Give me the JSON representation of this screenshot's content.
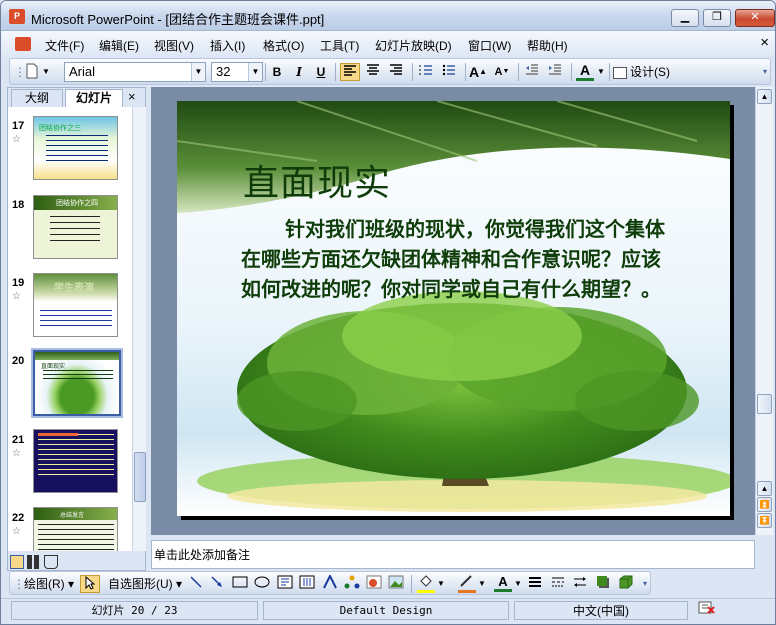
{
  "window": {
    "app_icon_text": "P",
    "title": "Microsoft PowerPoint - [团结合作主题班会课件.ppt]"
  },
  "caption_buttons": {
    "minimize": "▁",
    "restore": "❐",
    "close": "✕"
  },
  "menu": [
    "文件(F)",
    "编辑(E)",
    "视图(V)",
    "插入(I)",
    "格式(O)",
    "工具(T)",
    "幻灯片放映(D)",
    "窗口(W)",
    "帮助(H)"
  ],
  "menu_close": "×",
  "toolbar": {
    "font_name": "Arial",
    "font_size": "32",
    "bold": "B",
    "italic": "I",
    "underline": "U",
    "increase_font": "A",
    "decrease_font": "A",
    "font_color": "A",
    "design_label": "设计(S)"
  },
  "panel": {
    "tab_outline": "大纲",
    "tab_slides": "幻灯片",
    "close": "×"
  },
  "slides": [
    {
      "num": "17",
      "star": "☆",
      "title": "团结协作之三"
    },
    {
      "num": "18",
      "star": "",
      "title": "团结协作之四"
    },
    {
      "num": "19",
      "star": "☆",
      "title": "学生表演"
    },
    {
      "num": "20",
      "star": "",
      "title": "直面现实"
    },
    {
      "num": "21",
      "star": "☆",
      "title": ""
    },
    {
      "num": "22",
      "star": "☆",
      "title": "总结发言"
    }
  ],
  "selected_slide": "20",
  "slide": {
    "title": "直面现实",
    "body": "针对我们班级的现状，你觉得我们这个集体在哪些方面还欠缺团体精神和合作意识呢？应该如何改进的呢？你对同学或自己有什么期望？。"
  },
  "notes_placeholder": "单击此处添加备注",
  "drawing": {
    "draw_label": "绘图(R)",
    "autoshapes_label": "自选图形(U)"
  },
  "status": {
    "slide_info": "幻灯片 20 / 23",
    "design": "Default Design",
    "language": "中文(中国)"
  },
  "colors": {
    "accent": "#3b5da5",
    "slide_text": "#0f3d0a"
  }
}
